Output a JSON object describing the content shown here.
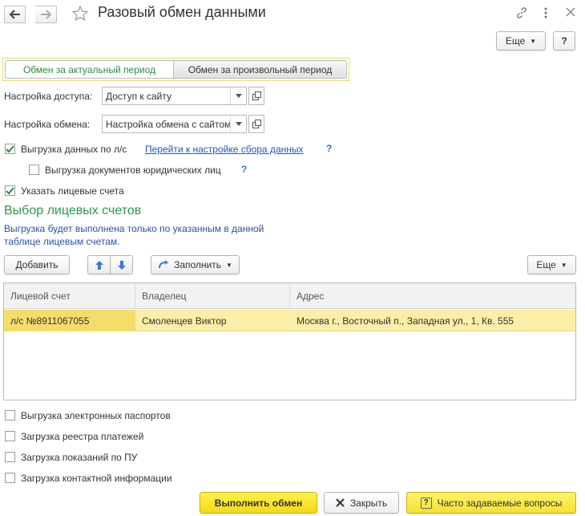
{
  "window": {
    "title": "Разовый обмен данными",
    "more_label": "Еще",
    "help_label": "?"
  },
  "tabs": [
    {
      "label": "Обмен за актуальный период",
      "active": true
    },
    {
      "label": "Обмен за произвольный период",
      "active": false
    }
  ],
  "form": {
    "access_label": "Настройка доступа:",
    "access_value": "Доступ к сайту",
    "exchange_label": "Настройка обмена:",
    "exchange_value": "Настройка обмена с сайтом",
    "upload_by_ls_label": "Выгрузка данных по л/с",
    "upload_by_ls_checked": true,
    "collect_settings_link": "Перейти к настройке сбора данных",
    "upload_legal_docs_label": "Выгрузка документов юридических лиц",
    "upload_legal_docs_checked": false,
    "specify_accounts_label": "Указать лицевые счета",
    "specify_accounts_checked": true,
    "help_mark": "?"
  },
  "accounts_section": {
    "title": "Выбор лицевых счетов",
    "info_line1": "Выгрузка будет выполнена только по указанным в данной",
    "info_line2": "таблице лицевым счетам."
  },
  "toolbar": {
    "add_label": "Добавить",
    "fill_label": "Заполнить",
    "more_label": "Еще"
  },
  "table": {
    "columns": [
      "Лицевой счет",
      "Владелец",
      "Адрес"
    ],
    "rows": [
      [
        "л/с №8911067055",
        "Смоленцев Виктор",
        "Москва г., Восточный п., Западная ул., 1, Кв. 555"
      ]
    ]
  },
  "options": [
    {
      "label": "Выгрузка электронных паспортов",
      "checked": false
    },
    {
      "label": "Загрузка реестра платежей",
      "checked": false
    },
    {
      "label": "Загрузка показаний по ПУ",
      "checked": false
    },
    {
      "label": "Загрузка контактной информации",
      "checked": false
    }
  ],
  "footer": {
    "run_label": "Выполнить обмен",
    "close_label": "Закрыть",
    "faq_label": "Часто задаваемые вопросы"
  },
  "colors": {
    "accent_green": "#2a9a4a",
    "link_blue": "#1a5ab8",
    "selection_yellow": "#fbeea6",
    "primary_button": "#f3d91b"
  }
}
